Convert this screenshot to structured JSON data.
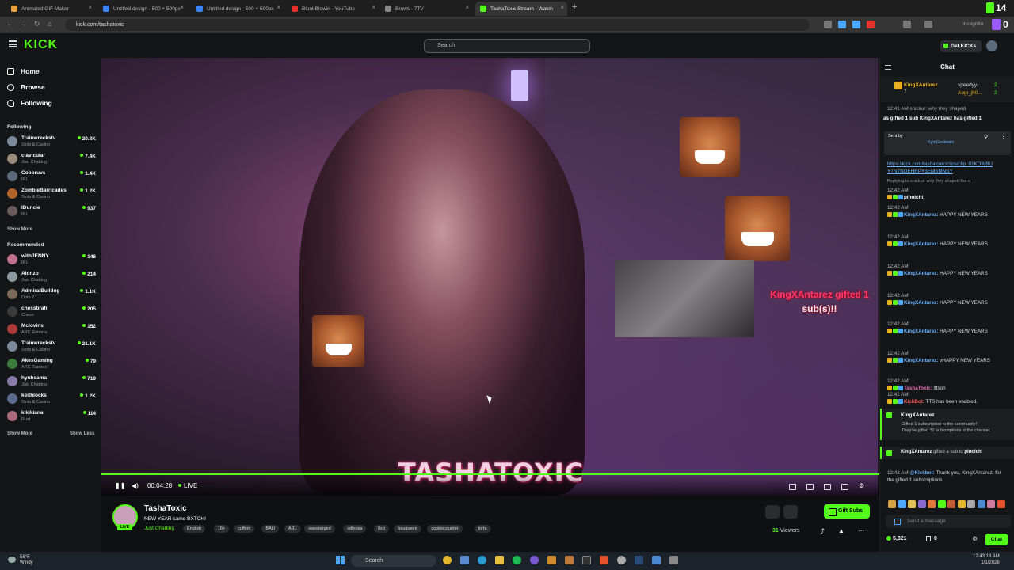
{
  "browser": {
    "tabs": [
      {
        "label": "Animated GIF Maker",
        "color": "#e9a23b"
      },
      {
        "label": "Untitled design - 500 × 500px",
        "color": "#3b82f6"
      },
      {
        "label": "Untitled design - 500 × 500px",
        "color": "#3b82f6"
      },
      {
        "label": "Blunt Blowin - YouTube",
        "color": "#e5322d"
      },
      {
        "label": "Brows - 7TV",
        "color": "#888888"
      },
      {
        "label": "TashaToxic Stream - Watch",
        "color": "#53fc18"
      }
    ],
    "url": "kick.com/tashatoxic",
    "incognito_label": "Incognito",
    "badge_14": "14",
    "badge_0": "0"
  },
  "header": {
    "logo": "KICK",
    "search_placeholder": "Search",
    "get_kicks": "Get KICKs"
  },
  "sidebar": {
    "nav": [
      {
        "label": "Home"
      },
      {
        "label": "Browse"
      },
      {
        "label": "Following"
      }
    ],
    "following_title": "Following",
    "following": [
      {
        "name": "Trainwreckstv",
        "category": "Slots & Casino",
        "viewers": "20.8K",
        "color": "#7a8a9a"
      },
      {
        "name": "clavicular",
        "category": "Just Chatting",
        "viewers": "7.4K",
        "color": "#9a8a7a"
      },
      {
        "name": "Cobbruvs",
        "category": "IRL",
        "viewers": "1.4K",
        "color": "#5a6a7a"
      },
      {
        "name": "ZombieBarricades",
        "category": "Slots & Casino",
        "viewers": "1.2K",
        "color": "#b0642a"
      },
      {
        "name": "IDuncle",
        "category": "IRL",
        "viewers": "937",
        "color": "#6a5a5a"
      }
    ],
    "show_more_1": "Show More",
    "recommended_title": "Recommended",
    "recommended": [
      {
        "name": "withJENNY",
        "category": "IRL",
        "viewers": "146",
        "color": "#c0708a"
      },
      {
        "name": "Alonzo",
        "category": "Just Chatting",
        "viewers": "214",
        "color": "#8a9aa0"
      },
      {
        "name": "AdmiralBulldog",
        "category": "Dota 2",
        "viewers": "1.1K",
        "color": "#7a6a5a"
      },
      {
        "name": "chessbrah",
        "category": "Chess",
        "viewers": "205",
        "color": "#3a3a3a"
      },
      {
        "name": "Mclovins",
        "category": "ARC Raiders",
        "viewers": "152",
        "color": "#aa3a3a"
      },
      {
        "name": "Trainwreckstv",
        "category": "Slots & Casino",
        "viewers": "21.1K",
        "color": "#7a8a9a"
      },
      {
        "name": "AkesGaming",
        "category": "ARC Raiders",
        "viewers": "79",
        "color": "#3a7a3a"
      },
      {
        "name": "hyubsama",
        "category": "Just Chatting",
        "viewers": "719",
        "color": "#8a7aaa"
      },
      {
        "name": "keithlocks",
        "category": "Slots & Casino",
        "viewers": "1.2K",
        "color": "#5a6a8a"
      },
      {
        "name": "kikikiana",
        "category": "Rust",
        "viewers": "114",
        "color": "#aa6a7a"
      }
    ],
    "show_more_2": "Show More",
    "show_less": "Show Less"
  },
  "video": {
    "gift_alert_user": "KingXAntarez gifted 1",
    "gift_alert_suffix": "sub(s)!!",
    "overlay_name": "TASHATOXIC",
    "time": "00:04:28",
    "live_label": "LIVE"
  },
  "stream": {
    "name": "TashaToxic",
    "title": "NEW YEAR same BXTCH!",
    "category": "Just Chatting",
    "tags": [
      "English",
      "18+",
      "cuffem",
      "BALI",
      "ARL",
      "sweaterged",
      "adinosa",
      "0xd",
      "bauqueen",
      "cookiecounter",
      "torta"
    ],
    "gift_subs": "Gift Subs",
    "viewers": "31",
    "viewers_label": "Viewers",
    "live_badge": "LIVE"
  },
  "chat": {
    "title": "Chat",
    "leaderboard": [
      {
        "name": "KingXAntarez",
        "count": "7"
      },
      {
        "name": "speedyy...",
        "count": "2"
      },
      {
        "name": "Augi_jh0...",
        "count": "2"
      }
    ],
    "ticker": "as gifted 1 sub   KingXAntarez has gifted 1",
    "ticker_reply": "12:41 AM  snickur: why they shaped",
    "pinned_sent_by": "Sent by",
    "pinned_user": "KyleCocktaile",
    "link_1": "https://kick.com/tashatoxic/clips/clip_01KDWBU",
    "link_2": "YTN7NOEHRPY3EMSMNSY",
    "reply_note": "Replying to snickur: why they shaped like q",
    "messages": [
      {
        "time": "12:42 AM",
        "user": "pinoichi:",
        "text": ""
      },
      {
        "time": "12:42 AM",
        "user": "KingXAntarez:",
        "text": "HAPPY NEW YEARS"
      },
      {
        "time": "12:42 AM",
        "user": "KingXAntarez:",
        "text": "HAPPY NEW YEARS"
      },
      {
        "time": "12:42 AM",
        "user": "KingXAntarez:",
        "text": "HAPPY NEW YEARS"
      },
      {
        "time": "12:42 AM",
        "user": "KingXAntarez:",
        "text": "HAPPY NEW YEARS"
      },
      {
        "time": "12:42 AM",
        "user": "KingXAntarez:",
        "text": "HAPPY NEW YEARS"
      },
      {
        "time": "12:42 AM",
        "user": "KingXAntarez:",
        "text": "vHAPPY NEW YEARS"
      },
      {
        "time": "12:42 AM",
        "user": "TashaToxic:",
        "text": "lttson"
      },
      {
        "time": "12:42 AM",
        "user": "KickBot:",
        "text": "TTS has been enabled."
      }
    ],
    "gift_block_user": "KingXAntarez",
    "gift_block_line1": "Gifted 1 subscription to the community!",
    "gift_block_line2": "They've gifted 32 subscriptions in the channel.",
    "gift_line_user": "KingXAntarez",
    "gift_line_text": "gifted a sub to",
    "gift_line_target": "pinoichi",
    "last_msg_time": "12:43 AM",
    "last_msg_user": "@Kickbot:",
    "last_msg_text": "Thank you, KingXAntarez, for the gifted 1 subscriptions.",
    "input_placeholder": "Send a message",
    "kicks": "5,321",
    "subs": "0",
    "chat_button": "Chat"
  },
  "taskbar": {
    "temp": "58°F",
    "condition": "Windy",
    "search": "Search",
    "time": "12:43:18 AM",
    "date": "1/1/2026"
  }
}
